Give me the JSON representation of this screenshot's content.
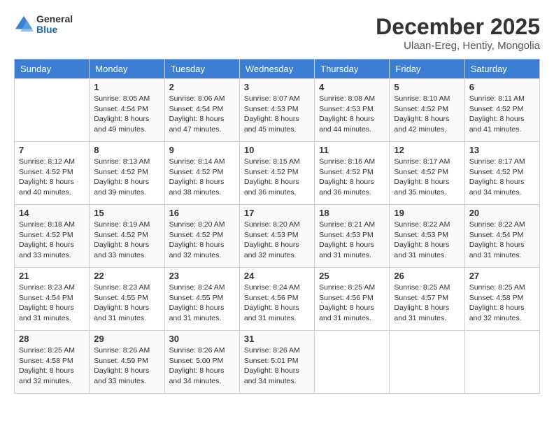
{
  "logo": {
    "general": "General",
    "blue": "Blue"
  },
  "title": {
    "month": "December 2025",
    "location": "Ulaan-Ereg, Hentiy, Mongolia"
  },
  "header_days": [
    "Sunday",
    "Monday",
    "Tuesday",
    "Wednesday",
    "Thursday",
    "Friday",
    "Saturday"
  ],
  "weeks": [
    [
      {
        "day": "",
        "info": ""
      },
      {
        "day": "1",
        "info": "Sunrise: 8:05 AM\nSunset: 4:54 PM\nDaylight: 8 hours\nand 49 minutes."
      },
      {
        "day": "2",
        "info": "Sunrise: 8:06 AM\nSunset: 4:54 PM\nDaylight: 8 hours\nand 47 minutes."
      },
      {
        "day": "3",
        "info": "Sunrise: 8:07 AM\nSunset: 4:53 PM\nDaylight: 8 hours\nand 45 minutes."
      },
      {
        "day": "4",
        "info": "Sunrise: 8:08 AM\nSunset: 4:53 PM\nDaylight: 8 hours\nand 44 minutes."
      },
      {
        "day": "5",
        "info": "Sunrise: 8:10 AM\nSunset: 4:52 PM\nDaylight: 8 hours\nand 42 minutes."
      },
      {
        "day": "6",
        "info": "Sunrise: 8:11 AM\nSunset: 4:52 PM\nDaylight: 8 hours\nand 41 minutes."
      }
    ],
    [
      {
        "day": "7",
        "info": "Sunrise: 8:12 AM\nSunset: 4:52 PM\nDaylight: 8 hours\nand 40 minutes."
      },
      {
        "day": "8",
        "info": "Sunrise: 8:13 AM\nSunset: 4:52 PM\nDaylight: 8 hours\nand 39 minutes."
      },
      {
        "day": "9",
        "info": "Sunrise: 8:14 AM\nSunset: 4:52 PM\nDaylight: 8 hours\nand 38 minutes."
      },
      {
        "day": "10",
        "info": "Sunrise: 8:15 AM\nSunset: 4:52 PM\nDaylight: 8 hours\nand 36 minutes."
      },
      {
        "day": "11",
        "info": "Sunrise: 8:16 AM\nSunset: 4:52 PM\nDaylight: 8 hours\nand 36 minutes."
      },
      {
        "day": "12",
        "info": "Sunrise: 8:17 AM\nSunset: 4:52 PM\nDaylight: 8 hours\nand 35 minutes."
      },
      {
        "day": "13",
        "info": "Sunrise: 8:17 AM\nSunset: 4:52 PM\nDaylight: 8 hours\nand 34 minutes."
      }
    ],
    [
      {
        "day": "14",
        "info": "Sunrise: 8:18 AM\nSunset: 4:52 PM\nDaylight: 8 hours\nand 33 minutes."
      },
      {
        "day": "15",
        "info": "Sunrise: 8:19 AM\nSunset: 4:52 PM\nDaylight: 8 hours\nand 33 minutes."
      },
      {
        "day": "16",
        "info": "Sunrise: 8:20 AM\nSunset: 4:52 PM\nDaylight: 8 hours\nand 32 minutes."
      },
      {
        "day": "17",
        "info": "Sunrise: 8:20 AM\nSunset: 4:53 PM\nDaylight: 8 hours\nand 32 minutes."
      },
      {
        "day": "18",
        "info": "Sunrise: 8:21 AM\nSunset: 4:53 PM\nDaylight: 8 hours\nand 31 minutes."
      },
      {
        "day": "19",
        "info": "Sunrise: 8:22 AM\nSunset: 4:53 PM\nDaylight: 8 hours\nand 31 minutes."
      },
      {
        "day": "20",
        "info": "Sunrise: 8:22 AM\nSunset: 4:54 PM\nDaylight: 8 hours\nand 31 minutes."
      }
    ],
    [
      {
        "day": "21",
        "info": "Sunrise: 8:23 AM\nSunset: 4:54 PM\nDaylight: 8 hours\nand 31 minutes."
      },
      {
        "day": "22",
        "info": "Sunrise: 8:23 AM\nSunset: 4:55 PM\nDaylight: 8 hours\nand 31 minutes."
      },
      {
        "day": "23",
        "info": "Sunrise: 8:24 AM\nSunset: 4:55 PM\nDaylight: 8 hours\nand 31 minutes."
      },
      {
        "day": "24",
        "info": "Sunrise: 8:24 AM\nSunset: 4:56 PM\nDaylight: 8 hours\nand 31 minutes."
      },
      {
        "day": "25",
        "info": "Sunrise: 8:25 AM\nSunset: 4:56 PM\nDaylight: 8 hours\nand 31 minutes."
      },
      {
        "day": "26",
        "info": "Sunrise: 8:25 AM\nSunset: 4:57 PM\nDaylight: 8 hours\nand 31 minutes."
      },
      {
        "day": "27",
        "info": "Sunrise: 8:25 AM\nSunset: 4:58 PM\nDaylight: 8 hours\nand 32 minutes."
      }
    ],
    [
      {
        "day": "28",
        "info": "Sunrise: 8:25 AM\nSunset: 4:58 PM\nDaylight: 8 hours\nand 32 minutes."
      },
      {
        "day": "29",
        "info": "Sunrise: 8:26 AM\nSunset: 4:59 PM\nDaylight: 8 hours\nand 33 minutes."
      },
      {
        "day": "30",
        "info": "Sunrise: 8:26 AM\nSunset: 5:00 PM\nDaylight: 8 hours\nand 34 minutes."
      },
      {
        "day": "31",
        "info": "Sunrise: 8:26 AM\nSunset: 5:01 PM\nDaylight: 8 hours\nand 34 minutes."
      },
      {
        "day": "",
        "info": ""
      },
      {
        "day": "",
        "info": ""
      },
      {
        "day": "",
        "info": ""
      }
    ]
  ]
}
